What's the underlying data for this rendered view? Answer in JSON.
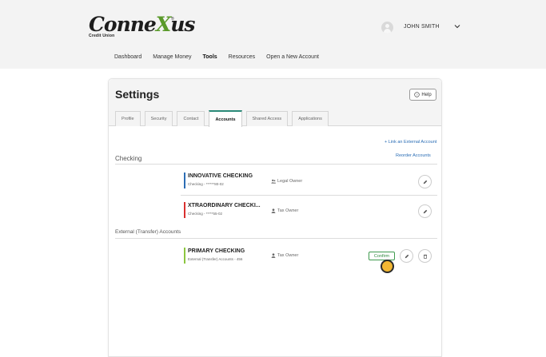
{
  "brand": {
    "logo_prefix": "Conne",
    "logo_x": "X",
    "logo_suffix": "us",
    "logo_sub": "Credit Union",
    "logo_reg": "®"
  },
  "header": {
    "username": "JOHN SMITH"
  },
  "nav": {
    "items": [
      {
        "label": "Dashboard"
      },
      {
        "label": "Manage Money"
      },
      {
        "label": "Tools"
      },
      {
        "label": "Resources"
      },
      {
        "label": "Open a New Account"
      }
    ],
    "active": "Tools"
  },
  "settings": {
    "title": "Settings",
    "help_label": "Help",
    "tabs": [
      {
        "label": "Profile"
      },
      {
        "label": "Security"
      },
      {
        "label": "Contact"
      },
      {
        "label": "Accounts"
      },
      {
        "label": "Shared Access"
      },
      {
        "label": "Applications"
      }
    ],
    "active_tab": "Accounts",
    "link_external": "+ Link an External Account",
    "reorder": "Reorder Accounts"
  },
  "sections": {
    "checking_label": "Checking",
    "external_label": "External (Transfer) Accounts"
  },
  "accounts": {
    "checking": [
      {
        "name": "INNOVATIVE CHECKING",
        "sub": "Checking - ******80-02",
        "owner": "Legal Owner",
        "color": "#2c6db4"
      },
      {
        "name": "XTRAORDINARY CHECKI...",
        "sub": "Checking - *****55-02",
        "owner": "Tax Owner",
        "color": "#d9302f"
      }
    ],
    "external": [
      {
        "name": "PRIMARY CHECKING",
        "sub": "External (Transfer) Accounts - 456",
        "owner": "Tax Owner",
        "color": "#8cc63f",
        "confirm_label": "Confirm"
      }
    ]
  },
  "colors": {
    "accent_tab": "#2a8a78",
    "link": "#2a6db5",
    "confirm": "#3e9a4e",
    "cursor": "#f2b733"
  }
}
